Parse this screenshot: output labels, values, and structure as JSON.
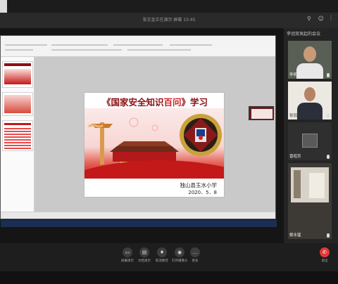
{
  "window": {
    "title": "张文金正在演示·屏幕 15:45"
  },
  "panel": {
    "title": "李冠双发起的会议"
  },
  "slide": {
    "title_pre": "《国家安全知识",
    "title_highlight": "百问",
    "title_post": "》学习",
    "school": "独山县玉水小学",
    "date": "2020．5．8"
  },
  "participants": [
    {
      "name": "李明元"
    },
    {
      "name": "张冠双"
    },
    {
      "name": "曾昭芳"
    },
    {
      "name": "黎永猛"
    }
  ],
  "controls": [
    {
      "label": "屏幕演示",
      "icon": "screen-share-icon",
      "glyph": "▭"
    },
    {
      "label": "文档演示",
      "icon": "document-icon",
      "glyph": "▤"
    },
    {
      "label": "取消静音",
      "icon": "microphone-icon",
      "glyph": "♦"
    },
    {
      "label": "打开摄像头",
      "icon": "camera-icon",
      "glyph": "◉"
    },
    {
      "label": "更多",
      "icon": "more-icon",
      "glyph": "…"
    }
  ],
  "end_button": {
    "label": "退出",
    "icon": "hangup-icon",
    "glyph": "✆"
  },
  "colors": {
    "accent_red": "#c41919",
    "end_red": "#e0383a"
  }
}
